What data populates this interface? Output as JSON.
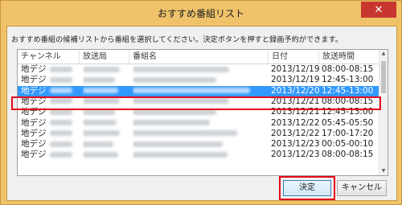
{
  "window": {
    "title": "おすすめ番組リスト",
    "close_glyph": "✕",
    "accent": "#f0c36a",
    "highlight_color": "#e5091a",
    "selection_color": "#3399ff"
  },
  "instruction": "おすすめ番組の候補リストから番組を選択してください。決定ボタンを押すと録画予約ができます。",
  "list": {
    "columns": [
      "チャンネル",
      "放送局",
      "番組名",
      "日付",
      "放送時間"
    ],
    "rows": [
      {
        "channel": "地デジ",
        "date": "2013/12/19",
        "time": "08:00-08:15",
        "selected": false
      },
      {
        "channel": "地デジ",
        "date": "2013/12/19",
        "time": "12:45-13:00",
        "selected": false
      },
      {
        "channel": "地デジ",
        "date": "2013/12/20",
        "time": "12:45-13:00",
        "selected": true
      },
      {
        "channel": "地デジ",
        "date": "2013/12/21",
        "time": "08:00-08:15",
        "selected": false
      },
      {
        "channel": "地デジ",
        "date": "2013/12/21",
        "time": "12:45-13:00",
        "selected": false
      },
      {
        "channel": "地デジ",
        "date": "2013/12/22",
        "time": "05:45-05:50",
        "selected": false
      },
      {
        "channel": "地デジ",
        "date": "2013/12/22",
        "time": "17:00-17:20",
        "selected": false
      },
      {
        "channel": "地デジ",
        "date": "2013/12/23",
        "time": "00:05-00:10",
        "selected": false
      },
      {
        "channel": "地デジ",
        "date": "2013/12/23",
        "time": "08:00-08:15",
        "selected": false
      }
    ]
  },
  "buttons": {
    "ok_label": "決定",
    "cancel_label": "キャンセル"
  },
  "scrollbar": {
    "up_icon": "▲",
    "down_icon": "▼"
  }
}
